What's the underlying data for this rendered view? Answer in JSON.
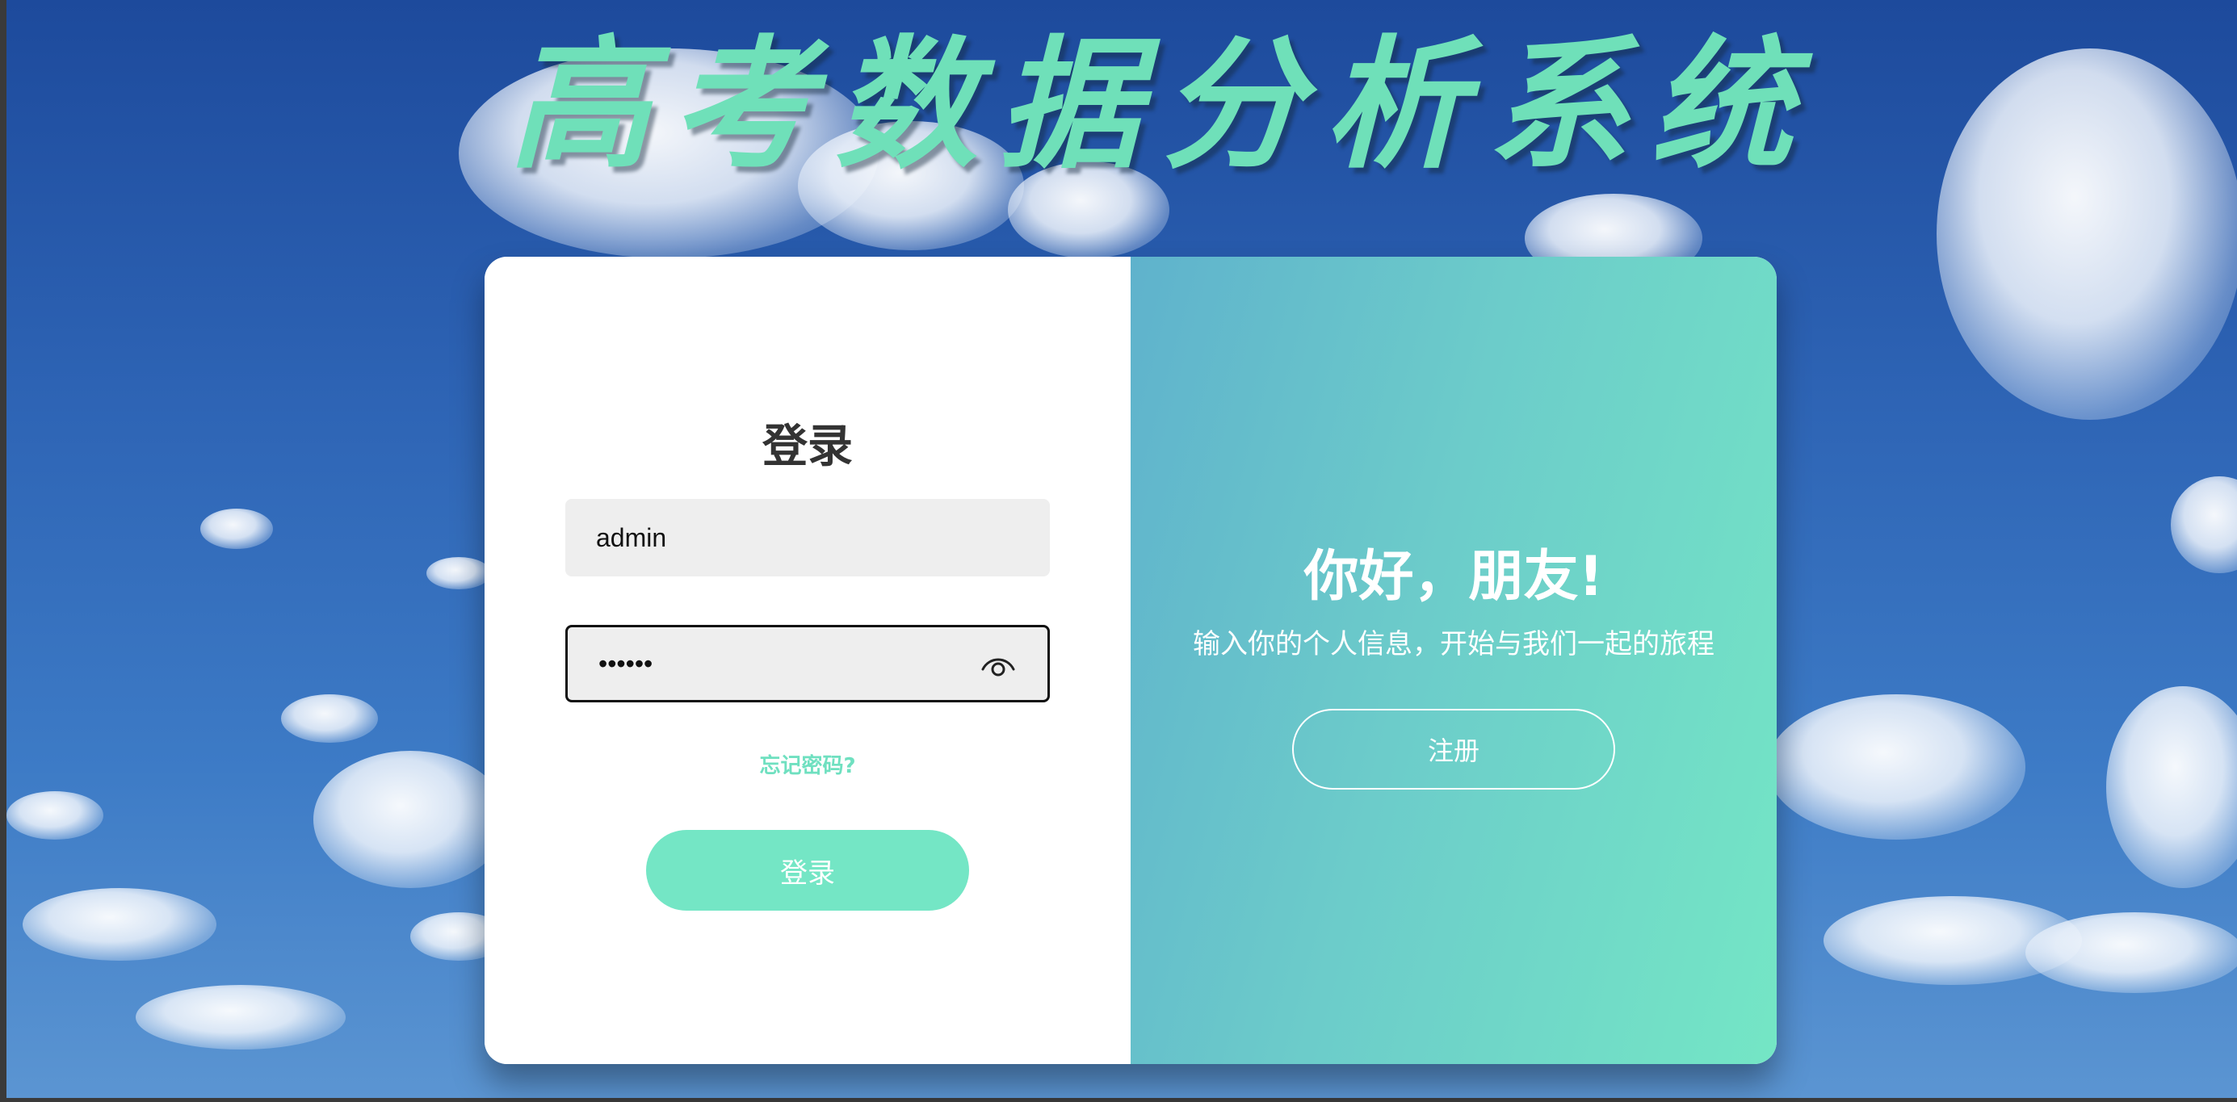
{
  "app": {
    "title": "高考数据分析系统"
  },
  "login": {
    "heading": "登录",
    "username": {
      "value": "admin",
      "placeholder": ""
    },
    "password": {
      "value": "••••••",
      "placeholder": ""
    },
    "forgot_password_link": "忘记密码?",
    "login_button": "登录"
  },
  "welcome": {
    "title": "你好，朋友!",
    "subtitle": "输入你的个人信息，开始与我们一起的旅程",
    "register_button": "注册"
  },
  "colors": {
    "accent": "#74e6c5",
    "title_text": "#6fe0b9",
    "heading_text": "#333333",
    "input_background": "#eeeeee",
    "welcome_gradient_start": "#5fb2cc",
    "welcome_gradient_end": "#74e6c5"
  },
  "icons": {
    "password_visibility": "eye-icon"
  }
}
